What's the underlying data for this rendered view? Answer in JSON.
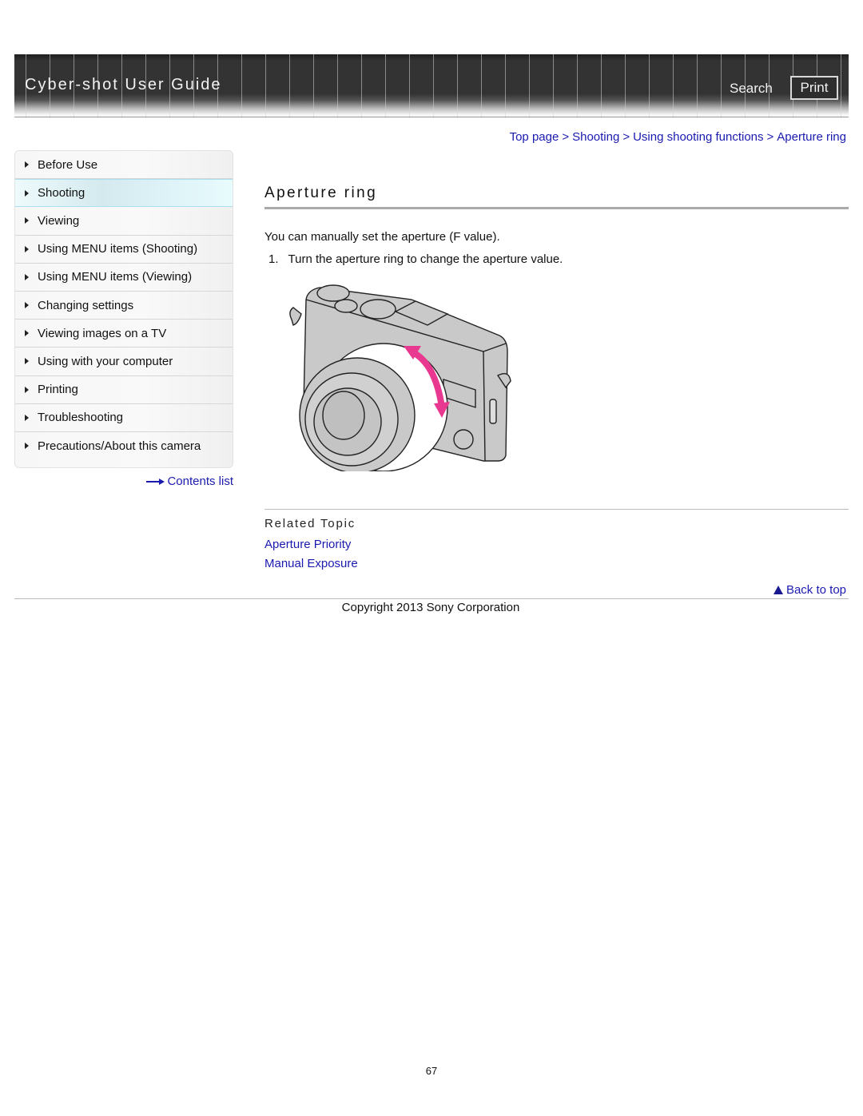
{
  "header": {
    "title": "Cyber-shot User Guide",
    "search_label": "Search",
    "print_label": "Print"
  },
  "breadcrumb": [
    {
      "label": "Top page"
    },
    {
      "label": "Shooting"
    },
    {
      "label": "Using shooting functions"
    },
    {
      "label": "Aperture ring"
    }
  ],
  "breadcrumb_separator": ">",
  "sidebar": {
    "items": [
      {
        "label": "Before Use",
        "active": false
      },
      {
        "label": "Shooting",
        "active": true
      },
      {
        "label": "Viewing",
        "active": false
      },
      {
        "label": "Using MENU items (Shooting)",
        "active": false
      },
      {
        "label": "Using MENU items (Viewing)",
        "active": false
      },
      {
        "label": "Changing settings",
        "active": false
      },
      {
        "label": "Viewing images on a TV",
        "active": false
      },
      {
        "label": "Using with your computer",
        "active": false
      },
      {
        "label": "Printing",
        "active": false
      },
      {
        "label": "Troubleshooting",
        "active": false
      },
      {
        "label": "Precautions/About this camera",
        "active": false
      }
    ],
    "contents_list_label": "Contents list"
  },
  "main": {
    "title": "Aperture ring",
    "intro": "You can manually set the aperture (F value).",
    "steps": [
      {
        "number": "1.",
        "text": "Turn the aperture ring to change the aperture value."
      }
    ],
    "illustration": "camera-aperture-ring-illustration",
    "arrow_color": "#e8388f",
    "related_topic_title": "Related Topic",
    "related_links": [
      {
        "label": "Aperture Priority"
      },
      {
        "label": "Manual Exposure"
      }
    ]
  },
  "footer": {
    "back_to_top_label": "Back to top",
    "copyright": "Copyright 2013 Sony Corporation",
    "page_number": "67"
  },
  "colors": {
    "link": "#1a1ab0",
    "active_nav": "#d4eaee",
    "banner": "#333333"
  }
}
